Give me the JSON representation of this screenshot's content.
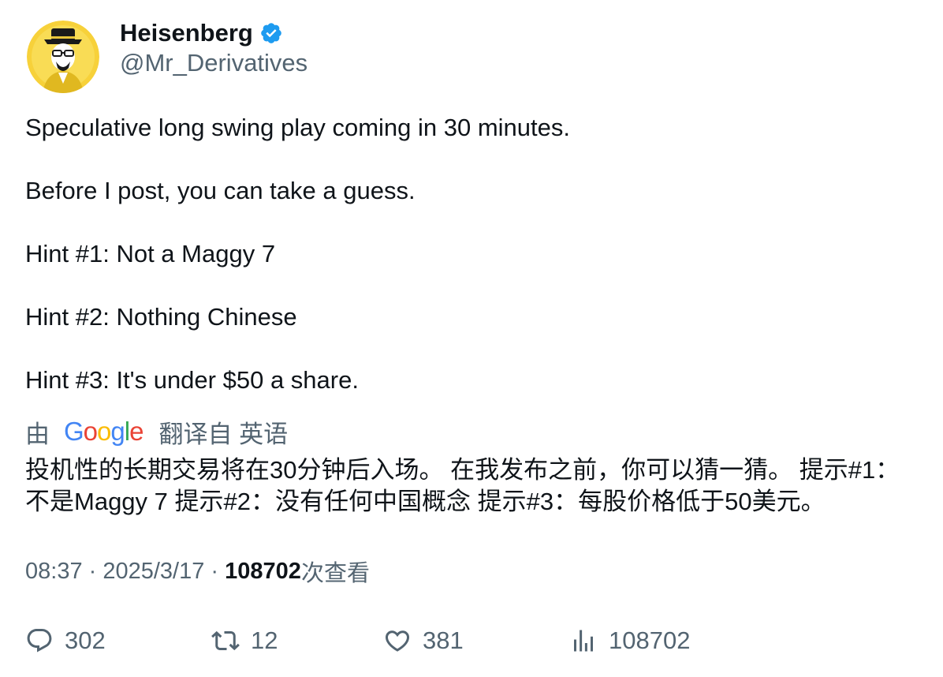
{
  "author": {
    "display_name": "Heisenberg",
    "handle": "@Mr_Derivatives",
    "verified": true,
    "avatar_icon": "heisenberg-avatar",
    "verified_color": "#1d9bf0"
  },
  "tweet": {
    "lines": [
      "Speculative long swing play coming in 30 minutes.",
      "Before I post, you can take a guess.",
      "Hint #1: Not a Maggy 7",
      "Hint #2: Nothing Chinese",
      "Hint #3: It's under $50 a share."
    ]
  },
  "translation": {
    "prefix": "由",
    "provider": "Google",
    "suffix": "翻译自 英语",
    "text": "投机性的长期交易将在30分钟后入场。 在我发布之前，你可以猜一猜。 提示#1：不是Maggy 7 提示#2：没有任何中国概念 提示#3：每股价格低于50美元。"
  },
  "meta": {
    "time": "08:37",
    "separator": " · ",
    "date": "2025/3/17",
    "views_count": "108702",
    "views_label": "次查看"
  },
  "actions": {
    "replies": "302",
    "retweets": "12",
    "likes": "381",
    "views": "108702"
  },
  "colors": {
    "text": "#0f1419",
    "secondary": "#536471",
    "accent": "#1d9bf0"
  }
}
